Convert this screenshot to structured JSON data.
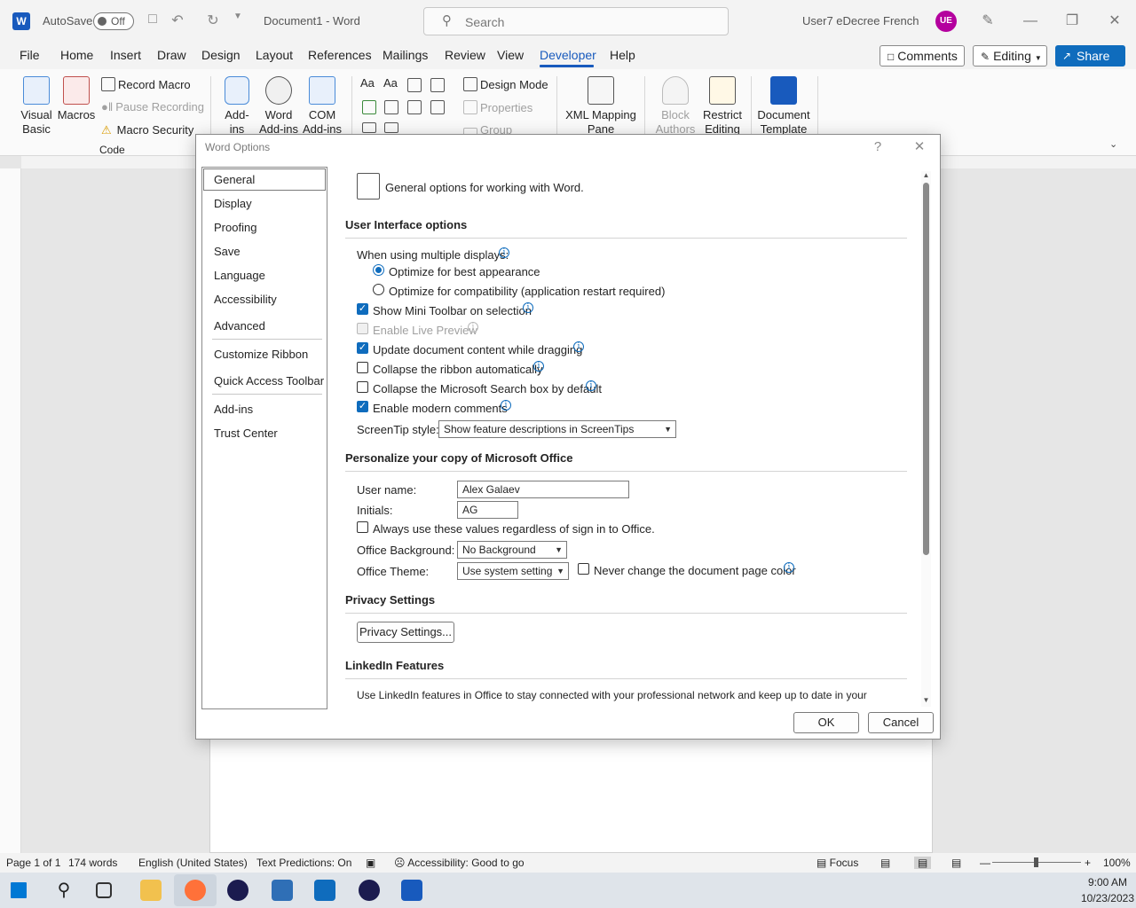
{
  "titlebar": {
    "autosave_label": "AutoSave",
    "autosave_state": "Off",
    "doc_title": "Document1  -  Word",
    "search_placeholder": "Search",
    "user_name": "User7 eDecree French",
    "user_initials": "UE"
  },
  "menu": {
    "tabs": [
      "File",
      "Home",
      "Insert",
      "Draw",
      "Design",
      "Layout",
      "References",
      "Mailings",
      "Review",
      "View",
      "Developer",
      "Help"
    ],
    "comments": "Comments",
    "editing": "Editing",
    "share": "Share"
  },
  "ribbon": {
    "visual_basic": "Visual Basic",
    "macros": "Macros",
    "record_macro": "Record Macro",
    "pause_recording": "Pause Recording",
    "macro_security": "Macro Security",
    "code_group": "Code",
    "add_ins": "Add-ins",
    "word_add_ins": "Word Add-ins",
    "com_add_ins": "COM Add-ins",
    "design_mode": "Design Mode",
    "properties": "Properties",
    "group": "Group",
    "xml_mapping": "XML Mapping Pane",
    "block_authors": "Block Authors",
    "restrict_editing": "Restrict Editing",
    "document_template": "Document Template"
  },
  "dialog": {
    "title": "Word Options",
    "help": "?",
    "nav": [
      "General",
      "Display",
      "Proofing",
      "Save",
      "Language",
      "Accessibility",
      "Advanced",
      "Customize Ribbon",
      "Quick Access Toolbar",
      "Add-ins",
      "Trust Center"
    ],
    "header": "General options for working with Word.",
    "ui_section": "User Interface options",
    "multiple_displays": "When using multiple displays:",
    "opt_best": "Optimize for best appearance",
    "opt_compat": "Optimize for compatibility (application restart required)",
    "mini_toolbar": "Show Mini Toolbar on selection",
    "live_preview": "Enable Live Preview",
    "update_dragging": "Update document content while dragging",
    "collapse_ribbon": "Collapse the ribbon automatically",
    "collapse_search": "Collapse the Microsoft Search box by default",
    "modern_comments": "Enable modern comments",
    "screentip_label": "ScreenTip style:",
    "screentip_value": "Show feature descriptions in ScreenTips",
    "personalize_section": "Personalize your copy of Microsoft Office",
    "username_label": "User name:",
    "username_value": "Alex Galaev",
    "initials_label": "Initials:",
    "initials_value": "AG",
    "always_use": "Always use these values regardless of sign in to Office.",
    "office_bg_label": "Office Background:",
    "office_bg_value": "No Background",
    "office_theme_label": "Office Theme:",
    "office_theme_value": "Use system setting",
    "never_change": "Never change the document page color",
    "privacy_section": "Privacy Settings",
    "privacy_button": "Privacy Settings...",
    "linkedin_section": "LinkedIn Features",
    "linkedin_text": "Use LinkedIn features in Office to stay connected with your professional network and keep up to date in your",
    "ok": "OK",
    "cancel": "Cancel"
  },
  "status": {
    "page": "Page 1 of 1",
    "words": "174 words",
    "language": "English (United States)",
    "predictions": "Text Predictions: On",
    "accessibility": "Accessibility: Good to go",
    "focus": "Focus",
    "zoom": "100%"
  },
  "taskbar": {
    "time": "9:00 AM",
    "date": "10/23/2023"
  }
}
